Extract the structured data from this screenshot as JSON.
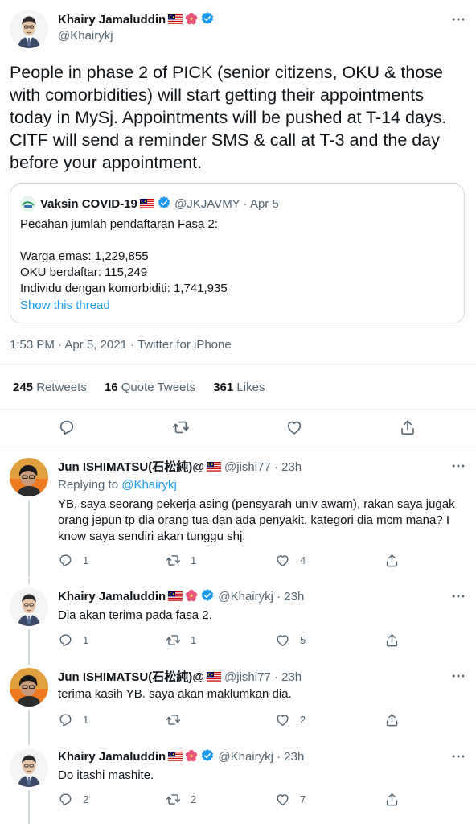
{
  "tweet": {
    "author_name": "Khairy Jamaluddin",
    "author_handle": "@Khairykj",
    "text": "People in phase 2 of PICK (senior citizens, OKU & those with comorbidities) will start getting their appointments today in MySj. Appointments will be pushed at T-14 days. CITF will send a reminder SMS & call at T-3 and the day before your appointment.",
    "quote": {
      "name": "Vaksin COVID-19",
      "handle": "@JKJAVMY",
      "dot": "·",
      "date": "Apr 5",
      "text": "Pecahan jumlah pendaftaran Fasa 2:\n\nWarga emas: 1,229,855\nOKU berdaftar: 115,249\nIndividu dengan komorbiditi: 1,741,935",
      "show_thread": "Show this thread"
    },
    "timestamp": "1:53 PM · Apr 5, 2021 · Twitter for iPhone",
    "retweets_count": "245",
    "retweets_label": "Retweets",
    "quotes_count": "16",
    "quotes_label": "Quote Tweets",
    "likes_count": "361",
    "likes_label": "Likes"
  },
  "replies": [
    {
      "name": "Jun ISHIMATSU(石松純)@",
      "handle": "@jishi77",
      "time": "· 23h",
      "replying_prefix": "Replying to",
      "replying_to": "@Khairykj",
      "text": "YB, saya seorang pekerja asing (pensyarah univ awam), rakan saya jugak orang jepun tp dia orang tua dan ada penyakit. kategori dia mcm mana? I know saya sendiri akan tunggu shj.",
      "reply_count": "1",
      "retweet_count": "1",
      "like_count": "4"
    },
    {
      "name": "Khairy Jamaluddin",
      "handle": "@Khairykj",
      "time": "· 23h",
      "text": "Dia akan terima pada fasa 2.",
      "reply_count": "1",
      "retweet_count": "1",
      "like_count": "5"
    },
    {
      "name": "Jun ISHIMATSU(石松純)@",
      "handle": "@jishi77",
      "time": "· 23h",
      "text": "terima kasih YB. saya akan maklumkan dia.",
      "reply_count": "1",
      "retweet_count": "",
      "like_count": "2"
    },
    {
      "name": "Khairy Jamaluddin",
      "handle": "@Khairykj",
      "time": "· 23h",
      "text": "Do itashi mashite.",
      "reply_count": "2",
      "retweet_count": "2",
      "like_count": "7"
    }
  ],
  "colors": {
    "accent": "#1d9bf0",
    "text": "#0f1419",
    "muted": "#536471",
    "border": "#cfd9de"
  },
  "icons": [
    "more-icon",
    "reply-icon",
    "retweet-icon",
    "like-icon",
    "share-icon",
    "verified-icon",
    "malaysia-flag-icon",
    "hibiscus-icon"
  ]
}
